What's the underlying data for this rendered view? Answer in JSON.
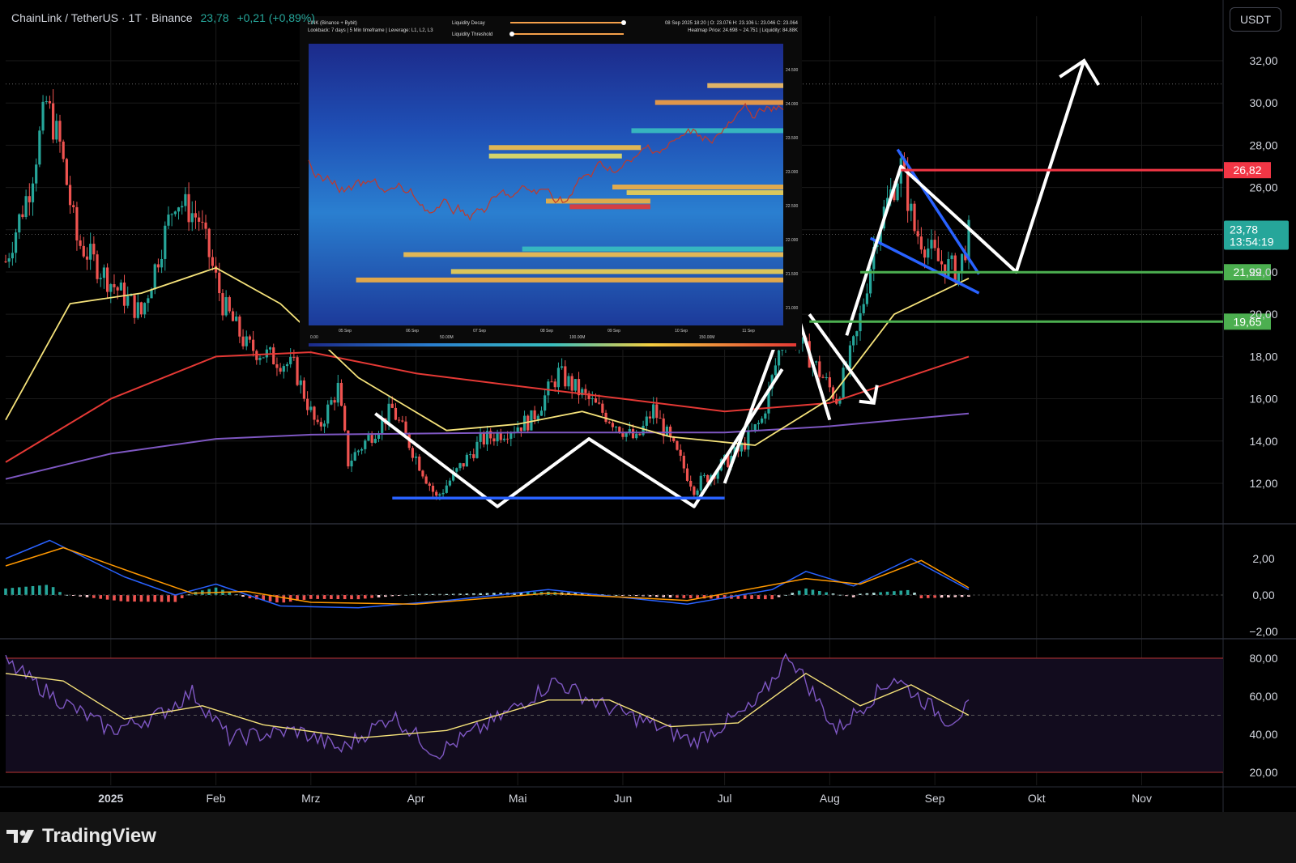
{
  "header": {
    "symbol": "ChainLink / TetherUS · 1T · Binance",
    "price": "23,78",
    "change": "+0,21 (+0,89%)"
  },
  "currency_button": "USDT",
  "footer": {
    "brand": "TradingView"
  },
  "inset": {
    "legend_left_1": "LINK (Binance + Bybit)",
    "legend_left_2": "Lookback: 7 days | 5 Min timeframe | Leverage: L1, L2, L3",
    "slider_1": "Liquidity Decay",
    "slider_2": "Liquidity Threshold",
    "legend_right_1": "08 Sep 2025 18:20 | O: 23.076 H: 23.106 L: 23.046 C: 23.064",
    "legend_right_2": "Heatmap Price: 24.698 ~ 24.751 | Liquidity: 84.88K",
    "x_labels": [
      "05 Sep",
      "06 Sep",
      "07 Sep",
      "08 Sep",
      "09 Sep",
      "10 Sep",
      "11 Sep"
    ],
    "y_labels": [
      "24.500",
      "24.000",
      "23.500",
      "23.000",
      "22.500",
      "22.000",
      "21.500",
      "21.000"
    ],
    "scale_labels": [
      "0.00",
      "50.00M",
      "100.00M",
      "150.00M"
    ]
  },
  "colors": {
    "up": "#26a69a",
    "down": "#ef5350",
    "ma50": "#f5e27a",
    "ma200": "#e53935",
    "ma_long": "#7e57c2",
    "level_red": "#f23645",
    "level_green": "#4caf50",
    "price_tag": "#26a69a",
    "pattern_blue": "#2962ff"
  },
  "chart_data": [
    {
      "type": "candlestick",
      "title": "ChainLink / TetherUS · 1T · Binance",
      "x_labels": [
        "2025",
        "Feb",
        "Mrz",
        "Apr",
        "Mai",
        "Jun",
        "Jul",
        "Aug",
        "Sep",
        "Okt",
        "Nov"
      ],
      "y_ticks": [
        "32,00",
        "30,00",
        "28,00",
        "26,00",
        "24,00",
        "22,00",
        "20,00",
        "18,00",
        "16,00",
        "14,00",
        "12,00"
      ],
      "ylim": [
        10.9,
        33.5
      ],
      "price_path": [
        {
          "x": "2024-12-01",
          "y": 22.5
        },
        {
          "x": "2024-12-08",
          "y": 26.0
        },
        {
          "x": "2024-12-13",
          "y": 30.0
        },
        {
          "x": "2024-12-17",
          "y": 28.0
        },
        {
          "x": "2024-12-22",
          "y": 23.5
        },
        {
          "x": "2025-01-01",
          "y": 21.5
        },
        {
          "x": "2025-01-10",
          "y": 20.0
        },
        {
          "x": "2025-01-20",
          "y": 25.5
        },
        {
          "x": "2025-01-27",
          "y": 24.5
        },
        {
          "x": "2025-02-03",
          "y": 20.5
        },
        {
          "x": "2025-02-10",
          "y": 18.5
        },
        {
          "x": "2025-02-24",
          "y": 17.5
        },
        {
          "x": "2025-03-03",
          "y": 14.5
        },
        {
          "x": "2025-03-09",
          "y": 16.5
        },
        {
          "x": "2025-03-12",
          "y": 13.0
        },
        {
          "x": "2025-03-25",
          "y": 15.5
        },
        {
          "x": "2025-04-07",
          "y": 11.3
        },
        {
          "x": "2025-04-20",
          "y": 14.0
        },
        {
          "x": "2025-05-05",
          "y": 15.0
        },
        {
          "x": "2025-05-13",
          "y": 17.2
        },
        {
          "x": "2025-05-25",
          "y": 15.5
        },
        {
          "x": "2025-06-05",
          "y": 14.0
        },
        {
          "x": "2025-06-10",
          "y": 15.5
        },
        {
          "x": "2025-06-22",
          "y": 11.8
        },
        {
          "x": "2025-07-05",
          "y": 13.5
        },
        {
          "x": "2025-07-12",
          "y": 15.0
        },
        {
          "x": "2025-07-19",
          "y": 19.5
        },
        {
          "x": "2025-07-26",
          "y": 18.0
        },
        {
          "x": "2025-08-03",
          "y": 16.0
        },
        {
          "x": "2025-08-09",
          "y": 19.0
        },
        {
          "x": "2025-08-15",
          "y": 24.0
        },
        {
          "x": "2025-08-22",
          "y": 27.0
        },
        {
          "x": "2025-08-26",
          "y": 24.0
        },
        {
          "x": "2025-09-02",
          "y": 22.5
        },
        {
          "x": "2025-09-08",
          "y": 22.0
        },
        {
          "x": "2025-09-11",
          "y": 23.78
        }
      ],
      "ma50": [
        {
          "x": "2024-12-01",
          "y": 15.0
        },
        {
          "x": "2024-12-20",
          "y": 20.5
        },
        {
          "x": "2025-01-10",
          "y": 21.0
        },
        {
          "x": "2025-02-01",
          "y": 22.2
        },
        {
          "x": "2025-02-20",
          "y": 20.5
        },
        {
          "x": "2025-03-15",
          "y": 17.0
        },
        {
          "x": "2025-04-10",
          "y": 14.5
        },
        {
          "x": "2025-05-01",
          "y": 14.8
        },
        {
          "x": "2025-05-20",
          "y": 15.4
        },
        {
          "x": "2025-06-15",
          "y": 14.2
        },
        {
          "x": "2025-07-10",
          "y": 13.8
        },
        {
          "x": "2025-08-01",
          "y": 16.0
        },
        {
          "x": "2025-08-20",
          "y": 20.0
        },
        {
          "x": "2025-09-11",
          "y": 21.7
        }
      ],
      "ma200": [
        {
          "x": "2024-12-01",
          "y": 13.0
        },
        {
          "x": "2025-01-01",
          "y": 16.0
        },
        {
          "x": "2025-02-01",
          "y": 18.0
        },
        {
          "x": "2025-03-01",
          "y": 18.2
        },
        {
          "x": "2025-04-01",
          "y": 17.2
        },
        {
          "x": "2025-05-01",
          "y": 16.6
        },
        {
          "x": "2025-06-01",
          "y": 16.0
        },
        {
          "x": "2025-07-01",
          "y": 15.4
        },
        {
          "x": "2025-08-01",
          "y": 15.8
        },
        {
          "x": "2025-09-11",
          "y": 18.0
        }
      ],
      "ma_long": [
        {
          "x": "2024-12-01",
          "y": 12.2
        },
        {
          "x": "2025-01-01",
          "y": 13.4
        },
        {
          "x": "2025-02-01",
          "y": 14.1
        },
        {
          "x": "2025-03-01",
          "y": 14.3
        },
        {
          "x": "2025-05-01",
          "y": 14.4
        },
        {
          "x": "2025-07-01",
          "y": 14.4
        },
        {
          "x": "2025-08-01",
          "y": 14.7
        },
        {
          "x": "2025-09-11",
          "y": 15.3
        }
      ],
      "levels": [
        {
          "value": 26.82,
          "label": "26,82",
          "color": "#f23645"
        },
        {
          "value": 21.99,
          "label": "21,99",
          "color": "#4caf50"
        },
        {
          "value": 19.65,
          "label": "19,65",
          "color": "#4caf50"
        }
      ],
      "current_price": {
        "value": 23.78,
        "label": "23,78",
        "countdown": "13:54:19"
      },
      "annotations": {
        "w_pattern": [
          {
            "x": "2025-03-20",
            "y": 15.3
          },
          {
            "x": "2025-04-25",
            "y": 10.9
          },
          {
            "x": "2025-05-22",
            "y": 14.1
          },
          {
            "x": "2025-06-22",
            "y": 10.9
          },
          {
            "x": "2025-07-18",
            "y": 17.4
          }
        ],
        "support_line": [
          {
            "x": "2025-03-25",
            "y": 11.3
          },
          {
            "x": "2025-07-01",
            "y": 11.3
          }
        ],
        "impulse_up": [
          {
            "x": "2025-07-01",
            "y": 12.0
          },
          {
            "x": "2025-07-21",
            "y": 20.8
          },
          {
            "x": "2025-08-01",
            "y": 15.0
          }
        ],
        "pullback_arrow": [
          {
            "x": "2025-07-26",
            "y": 20.0
          },
          {
            "x": "2025-08-14",
            "y": 15.8
          }
        ],
        "impulse_2": [
          {
            "x": "2025-08-06",
            "y": 19.0
          },
          {
            "x": "2025-08-22",
            "y": 27.0
          },
          {
            "x": "2025-09-25",
            "y": 22.0
          },
          {
            "x": "2025-10-15",
            "y": 32.0
          }
        ],
        "wedge_upper": [
          {
            "x": "2025-08-21",
            "y": 27.8
          },
          {
            "x": "2025-09-14",
            "y": 21.9
          }
        ],
        "wedge_lower": [
          {
            "x": "2025-08-13",
            "y": 23.6
          },
          {
            "x": "2025-09-14",
            "y": 21.0
          }
        ],
        "dotted_line": 30.9
      }
    },
    {
      "type": "line",
      "title": "",
      "y_ticks": [
        "2,00",
        "0,00",
        "−2,00"
      ],
      "ylim": [
        -2.0,
        3.3
      ],
      "series": [
        {
          "values": [
            {
              "x": "2024-12-01",
              "y": 2.0
            },
            {
              "x": "2024-12-14",
              "y": 3.0
            },
            {
              "x": "2025-01-05",
              "y": 1.0
            },
            {
              "x": "2025-01-20",
              "y": 0.0
            },
            {
              "x": "2025-02-01",
              "y": 0.6
            },
            {
              "x": "2025-02-20",
              "y": -0.6
            },
            {
              "x": "2025-03-15",
              "y": -0.7
            },
            {
              "x": "2025-04-10",
              "y": -0.3
            },
            {
              "x": "2025-05-10",
              "y": 0.3
            },
            {
              "x": "2025-06-20",
              "y": -0.5
            },
            {
              "x": "2025-07-15",
              "y": 0.3
            },
            {
              "x": "2025-07-25",
              "y": 1.3
            },
            {
              "x": "2025-08-08",
              "y": 0.5
            },
            {
              "x": "2025-08-25",
              "y": 2.0
            },
            {
              "x": "2025-09-11",
              "y": 0.3
            }
          ]
        },
        {
          "values": [
            {
              "x": "2024-12-01",
              "y": 1.6
            },
            {
              "x": "2024-12-18",
              "y": 2.6
            },
            {
              "x": "2025-01-08",
              "y": 1.2
            },
            {
              "x": "2025-01-25",
              "y": 0.1
            },
            {
              "x": "2025-02-10",
              "y": 0.2
            },
            {
              "x": "2025-03-01",
              "y": -0.4
            },
            {
              "x": "2025-04-01",
              "y": -0.5
            },
            {
              "x": "2025-05-10",
              "y": 0.1
            },
            {
              "x": "2025-06-20",
              "y": -0.3
            },
            {
              "x": "2025-07-25",
              "y": 0.9
            },
            {
              "x": "2025-08-10",
              "y": 0.6
            },
            {
              "x": "2025-08-28",
              "y": 1.9
            },
            {
              "x": "2025-09-11",
              "y": 0.4
            }
          ]
        }
      ]
    },
    {
      "type": "line",
      "title": "",
      "y_ticks": [
        "80,00",
        "60,00",
        "40,00",
        "20,00"
      ],
      "ylim": [
        16,
        86
      ],
      "band": [
        20,
        80
      ],
      "midline": 50,
      "series": [
        {
          "values": [
            {
              "x": "2024-12-01",
              "y": 78
            },
            {
              "x": "2024-12-15",
              "y": 60
            },
            {
              "x": "2025-01-01",
              "y": 42
            },
            {
              "x": "2025-01-15",
              "y": 50
            },
            {
              "x": "2025-01-25",
              "y": 62
            },
            {
              "x": "2025-02-05",
              "y": 38
            },
            {
              "x": "2025-02-25",
              "y": 42
            },
            {
              "x": "2025-03-10",
              "y": 32
            },
            {
              "x": "2025-03-25",
              "y": 50
            },
            {
              "x": "2025-04-07",
              "y": 30
            },
            {
              "x": "2025-04-25",
              "y": 48
            },
            {
              "x": "2025-05-12",
              "y": 68
            },
            {
              "x": "2025-05-25",
              "y": 56
            },
            {
              "x": "2025-06-10",
              "y": 45
            },
            {
              "x": "2025-06-22",
              "y": 36
            },
            {
              "x": "2025-07-10",
              "y": 55
            },
            {
              "x": "2025-07-20",
              "y": 82
            },
            {
              "x": "2025-08-03",
              "y": 42
            },
            {
              "x": "2025-08-20",
              "y": 70
            },
            {
              "x": "2025-09-05",
              "y": 47
            },
            {
              "x": "2025-09-11",
              "y": 54
            }
          ]
        },
        {
          "values": [
            {
              "x": "2024-12-01",
              "y": 72
            },
            {
              "x": "2024-12-18",
              "y": 68
            },
            {
              "x": "2025-01-05",
              "y": 48
            },
            {
              "x": "2025-01-28",
              "y": 55
            },
            {
              "x": "2025-02-15",
              "y": 45
            },
            {
              "x": "2025-03-15",
              "y": 38
            },
            {
              "x": "2025-04-10",
              "y": 42
            },
            {
              "x": "2025-05-10",
              "y": 58
            },
            {
              "x": "2025-05-28",
              "y": 58
            },
            {
              "x": "2025-06-15",
              "y": 44
            },
            {
              "x": "2025-07-05",
              "y": 46
            },
            {
              "x": "2025-07-25",
              "y": 72
            },
            {
              "x": "2025-08-10",
              "y": 55
            },
            {
              "x": "2025-08-25",
              "y": 66
            },
            {
              "x": "2025-09-11",
              "y": 50
            }
          ]
        }
      ]
    }
  ]
}
